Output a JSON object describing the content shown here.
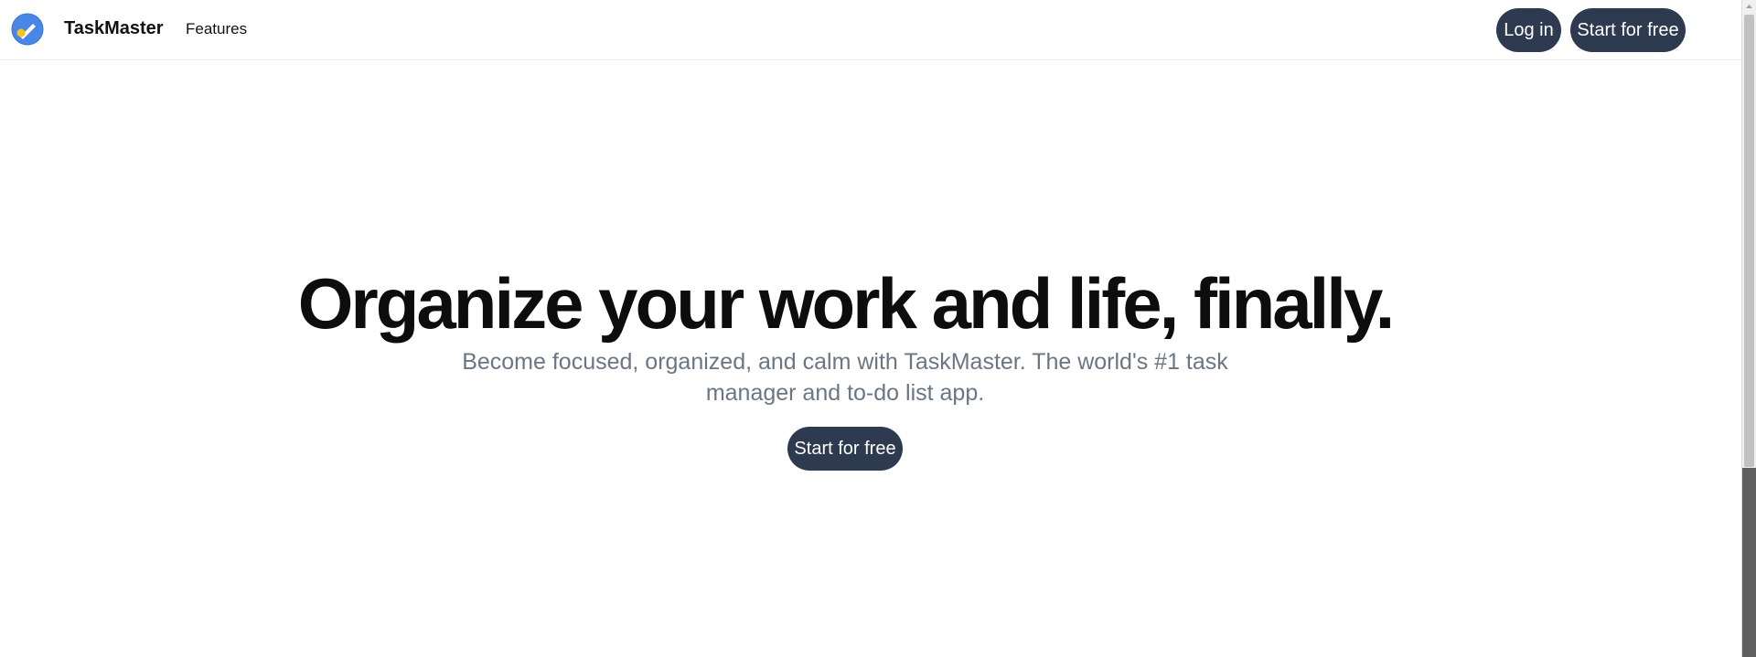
{
  "header": {
    "brand": "TaskMaster",
    "nav": {
      "features_label": "Features"
    },
    "login_label": "Log in",
    "start_label": "Start for free"
  },
  "hero": {
    "title": "Organize your work and life, finally.",
    "subtitle": "Become focused, organized, and calm with TaskMaster. The world's #1 task manager and to-do list app.",
    "cta_label": "Start for free"
  },
  "colors": {
    "button_bg": "#2d3a4f",
    "logo_blue": "#4a86e8",
    "logo_yellow": "#f5c518",
    "subtitle_gray": "#6b7685"
  },
  "icons": {
    "logo": "pencil-check-logo-icon",
    "scroll_up": "scroll-up-arrow-icon"
  }
}
